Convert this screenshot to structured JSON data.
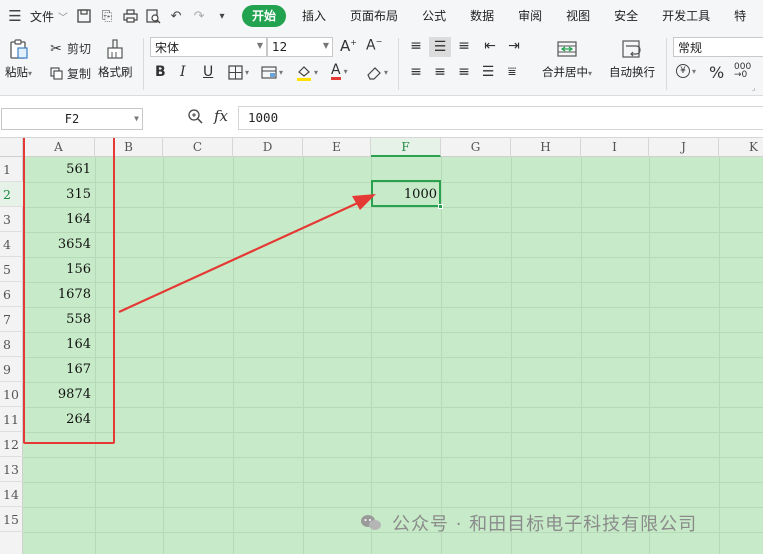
{
  "menubar": {
    "file_label": "文件",
    "tabs": [
      "开始",
      "插入",
      "页面布局",
      "公式",
      "数据",
      "审阅",
      "视图",
      "安全",
      "开发工具",
      "特"
    ]
  },
  "ribbon": {
    "paste": "粘贴",
    "cut": "剪切",
    "copy": "复制",
    "format_painter": "格式刷",
    "font_name": "宋体",
    "font_size": "12",
    "bold": "B",
    "italic": "I",
    "underline": "U",
    "merge_center": "合并居中",
    "wrap_text": "自动换行",
    "number_format": "常规",
    "percent": "%",
    "accent_color": "#21a34f"
  },
  "formula_bar": {
    "name_box": "F2",
    "fx_label": "fx",
    "formula_value": "1000"
  },
  "sheet": {
    "columns": [
      "A",
      "B",
      "C",
      "D",
      "E",
      "F",
      "G",
      "H",
      "I",
      "J",
      "K"
    ],
    "selected_column": "F",
    "rows": [
      "1",
      "2",
      "3",
      "4",
      "5",
      "6",
      "7",
      "8",
      "9",
      "10",
      "11",
      "12",
      "13",
      "14",
      "15"
    ],
    "selected_row": "2",
    "col_a_values": [
      "561",
      "315",
      "164",
      "3654",
      "156",
      "1678",
      "558",
      "164",
      "167",
      "9874",
      "264"
    ],
    "f2_value": "1000",
    "background_color": "#c7ebc8"
  },
  "watermark": {
    "text": "公众号 · 和田目标电子科技有限公司"
  }
}
